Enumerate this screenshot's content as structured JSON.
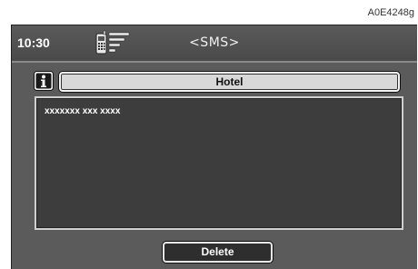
{
  "figure_code": "A0E4248g",
  "status_bar": {
    "time": "10:30",
    "phone_icon": "phone-signal-icon",
    "title": "<SMS>"
  },
  "message": {
    "info_icon": "info-icon",
    "sender": "Hotel",
    "body": "xxxxxxx xxx xxxx"
  },
  "actions": {
    "delete_label": "Delete"
  }
}
